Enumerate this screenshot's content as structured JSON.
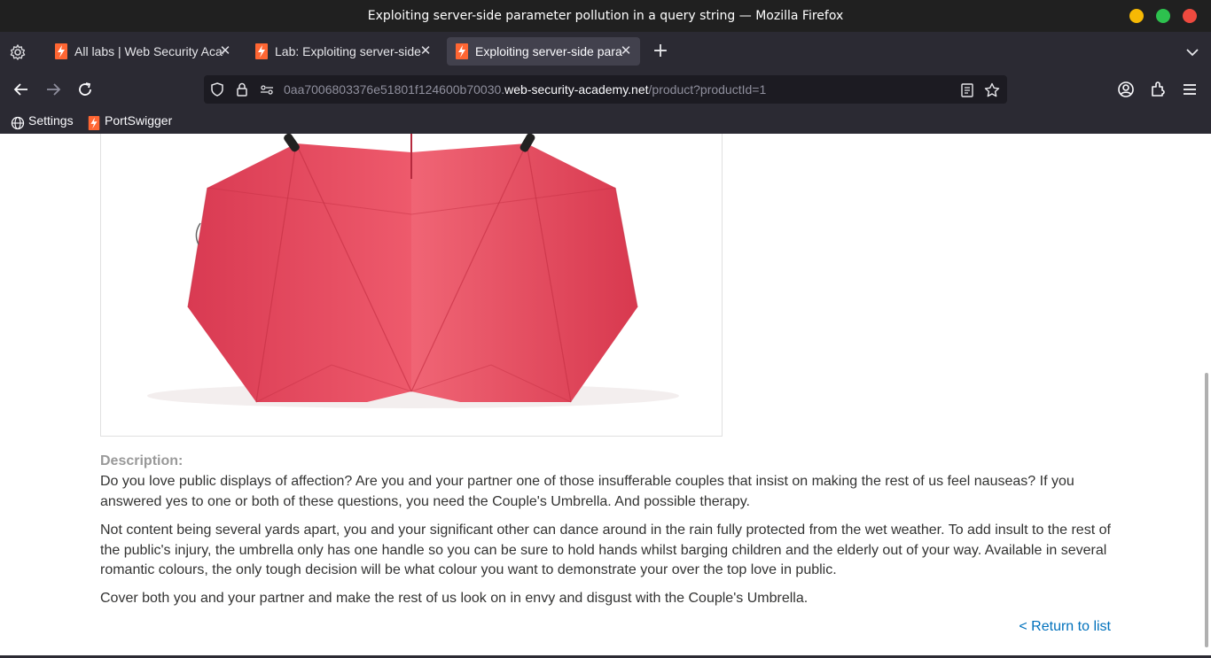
{
  "window": {
    "title": "Exploiting server-side parameter pollution in a query string — Mozilla Firefox"
  },
  "tabs": [
    {
      "label": "All labs | Web Security Academy",
      "active": false
    },
    {
      "label": "Lab: Exploiting server-side parameter pollution",
      "active": false
    },
    {
      "label": "Exploiting server-side parameter pollution",
      "active": true
    }
  ],
  "url": {
    "prefix": "0aa7006803376e51801f124600b70030.",
    "host": "web-security-academy.net",
    "path": "/product?productId=1"
  },
  "bookmarks": [
    {
      "label": "Settings",
      "icon": "globe-icon"
    },
    {
      "label": "PortSwigger",
      "icon": "portswigger-icon"
    }
  ],
  "product": {
    "image_alt": "Couple's Umbrella",
    "description_heading": "Description:",
    "paragraphs": [
      "Do you love public displays of affection? Are you and your partner one of those insufferable couples that insist on making the rest of us feel nauseas? If you answered yes to one or both of these questions, you need the Couple's Umbrella. And possible therapy.",
      "Not content being several yards apart, you and your significant other can dance around in the rain fully protected from the wet weather. To add insult to the rest of the public's injury, the umbrella only has one handle so you can be sure to hold hands whilst barging children and the elderly out of your way. Available in several romantic colours, the only tough decision will be what colour you want to demonstrate your over the top love in public.",
      "Cover both you and your partner and make the rest of us look on in envy and disgust with the Couple's Umbrella."
    ],
    "return_link": "< Return to list"
  },
  "colors": {
    "accent_link": "#0071bc",
    "portswigger_orange": "#ff6633",
    "umbrella_red": "#e84a5f"
  }
}
